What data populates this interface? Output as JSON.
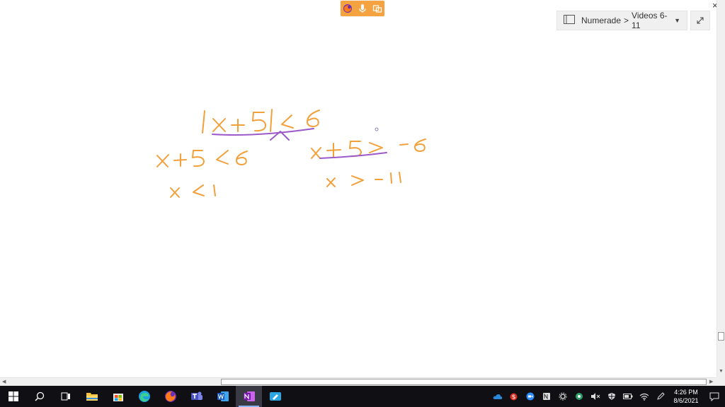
{
  "breadcrumb": {
    "notebook": "Numerade",
    "separator": ">",
    "section": "Videos 6-11"
  },
  "window": {
    "close_glyph": "×"
  },
  "ink_color": "#f2a03a",
  "highlight_color": "#9b59c9",
  "handwriting": [
    "|x + 5| < 6",
    "x + 5 < 6",
    "x < 1",
    "x + 5 > -6",
    "x > -11"
  ],
  "taskbar": {
    "apps": [
      "windows-start",
      "search",
      "task-view",
      "file-explorer",
      "microsoft-store",
      "edge",
      "firefox",
      "teams",
      "word",
      "onenote",
      "snip-sketch"
    ],
    "active_app": "onenote"
  },
  "clock": {
    "time": "4:26 PM",
    "date": "8/6/2021"
  }
}
